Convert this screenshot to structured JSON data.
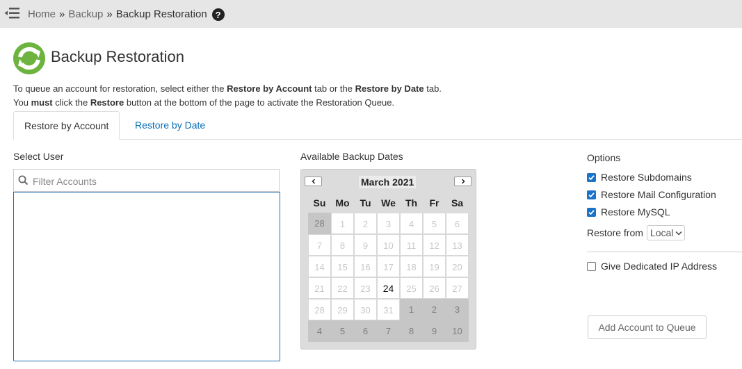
{
  "breadcrumb": {
    "items": [
      "Home",
      "Backup",
      "Backup Restoration"
    ],
    "separator": "»"
  },
  "help_icon_glyph": "?",
  "page": {
    "title": "Backup Restoration",
    "logo_icon": "refresh-circle-icon",
    "accent_color": "#6cb33f"
  },
  "intro": {
    "line1": {
      "t1": "To queue an account for restoration, select either the ",
      "b1": "Restore by Account",
      "t2": " tab or the ",
      "b2": "Restore by Date",
      "t3": " tab."
    },
    "line2": {
      "t1": "You ",
      "b1": "must",
      "t2": " click the ",
      "b2": "Restore",
      "t3": " button at the bottom of the page to activate the Restoration Queue."
    }
  },
  "tabs": [
    {
      "label": "Restore by Account",
      "active": true
    },
    {
      "label": "Restore by Date",
      "active": false
    }
  ],
  "select_user": {
    "label": "Select User",
    "filter_placeholder": "Filter Accounts",
    "filter_value": "",
    "users": []
  },
  "calendar": {
    "label": "Available Backup Dates",
    "month": "March 2021",
    "prev_icon": "chevron-left-icon",
    "next_icon": "chevron-right-icon",
    "weekdays": [
      "Su",
      "Mo",
      "Tu",
      "We",
      "Th",
      "Fr",
      "Sa"
    ],
    "weeks": [
      [
        28,
        1,
        2,
        3,
        4,
        5,
        6
      ],
      [
        7,
        8,
        9,
        10,
        11,
        12,
        13
      ],
      [
        14,
        15,
        16,
        17,
        18,
        19,
        20
      ],
      [
        21,
        22,
        23,
        24,
        25,
        26,
        27
      ],
      [
        28,
        29,
        30,
        31,
        1,
        2,
        3
      ],
      [
        4,
        5,
        6,
        7,
        8,
        9,
        10
      ]
    ],
    "outside_cells": [
      [
        0,
        0
      ],
      [
        4,
        4
      ],
      [
        4,
        5
      ],
      [
        4,
        6
      ],
      [
        5,
        0
      ],
      [
        5,
        1
      ],
      [
        5,
        2
      ],
      [
        5,
        3
      ],
      [
        5,
        4
      ],
      [
        5,
        5
      ],
      [
        5,
        6
      ]
    ],
    "available_cells": [
      [
        3,
        3
      ]
    ]
  },
  "options": {
    "label": "Options",
    "checkboxes": [
      {
        "label": "Restore Subdomains",
        "checked": true
      },
      {
        "label": "Restore Mail Configuration",
        "checked": true
      },
      {
        "label": "Restore MySQL",
        "checked": true
      }
    ],
    "restore_from_label": "Restore from",
    "restore_from_value": "Local",
    "dedicated_ip": {
      "label": "Give Dedicated IP Address",
      "checked": false
    }
  },
  "add_button_label": "Add Account to Queue"
}
